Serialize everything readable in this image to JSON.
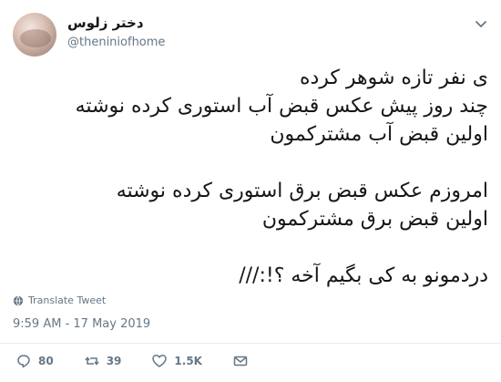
{
  "user": {
    "display_name": "دختر زلوس",
    "handle": "@theniniofhome"
  },
  "tweet": {
    "text": "ی نفر تازه شوهر کرده\nچند روز پیش عکس قبض آب استوری کرده نوشته\nاولین قبض آب مشترکمون\n\nامروزم عکس قبض برق استوری کرده نوشته\nاولین قبض  برق مشترکمون\n\nدردمونو به کی بگیم آخه ؟!:///",
    "translate_label": "Translate Tweet",
    "timestamp": "9:59 AM - 17 May 2019"
  },
  "actions": {
    "reply_count": "80",
    "retweet_count": "39",
    "like_count": "1.5K"
  },
  "icons": {
    "translate": "globe-icon",
    "options": "chevron-down-icon",
    "reply": "reply-icon",
    "retweet": "retweet-icon",
    "like": "heart-icon",
    "dm": "envelope-icon"
  },
  "colors": {
    "text": "#14171a",
    "secondary": "#657786",
    "separator": "#e6ecf0"
  }
}
